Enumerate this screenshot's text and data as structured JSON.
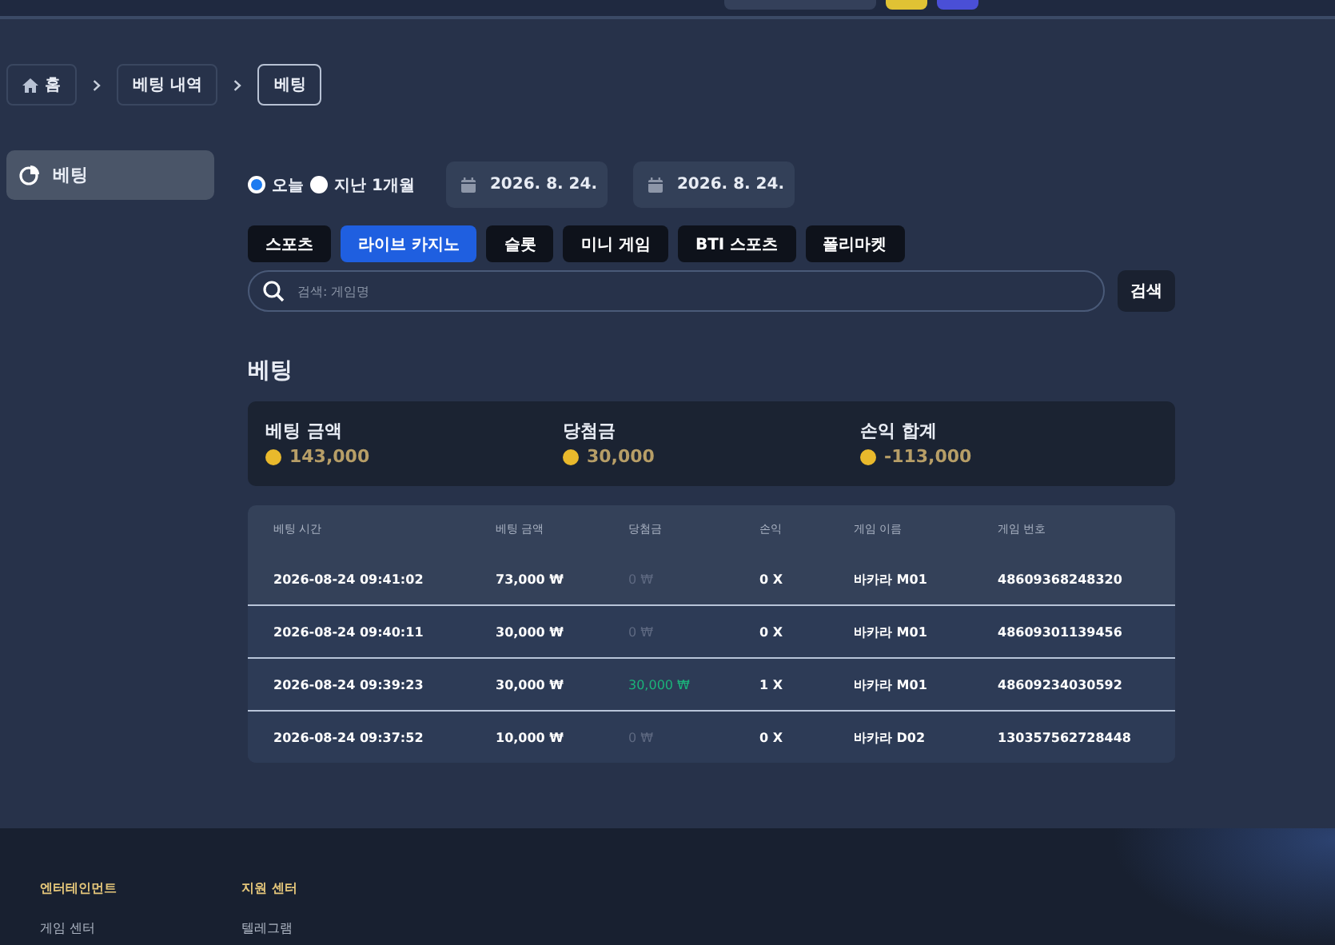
{
  "breadcrumb": [
    {
      "label": "홈",
      "kind": "home",
      "selected": false
    },
    {
      "label": "베팅 내역",
      "kind": "link",
      "selected": false
    },
    {
      "label": "베팅",
      "kind": "link",
      "selected": true
    }
  ],
  "sidebar": {
    "items": [
      {
        "label": "베팅",
        "selected": true
      }
    ]
  },
  "period": [
    {
      "label": "오늘",
      "selected": true
    },
    {
      "label": "지난 1개월",
      "selected": false
    }
  ],
  "dates": [
    "2026. 8. 24.",
    "2026. 8. 24."
  ],
  "categories": [
    {
      "label": "스포츠",
      "selected": false
    },
    {
      "label": "라이브 카지노",
      "selected": true
    },
    {
      "label": "슬롯",
      "selected": false
    },
    {
      "label": "미니 게임",
      "selected": false
    },
    {
      "label": "BTI 스포츠",
      "selected": false
    },
    {
      "label": "폴리마켓",
      "selected": false
    }
  ],
  "search": {
    "placeholder": "검색: 게임명",
    "button": "검색"
  },
  "section_title": "베팅",
  "summary": [
    {
      "label": "베팅 금액",
      "value": "143,000"
    },
    {
      "label": "당첨금",
      "value": "30,000"
    },
    {
      "label": "손익 합계",
      "value": "-113,000"
    }
  ],
  "table": {
    "columns": [
      "베팅 시간",
      "베팅 금액",
      "당첨금",
      "손익",
      "게임 이름",
      "게임 번호"
    ],
    "rows": [
      {
        "time": "2026-08-24 09:41:02",
        "amount": "73,000 ₩",
        "win": "0 ₩",
        "won": false,
        "profit": "0 X",
        "game": "바카라 M01",
        "number": "48609368248320"
      },
      {
        "time": "2026-08-24 09:40:11",
        "amount": "30,000 ₩",
        "win": "0 ₩",
        "won": false,
        "profit": "0 X",
        "game": "바카라 M01",
        "number": "48609301139456"
      },
      {
        "time": "2026-08-24 09:39:23",
        "amount": "30,000 ₩",
        "win": "30,000 ₩",
        "won": true,
        "profit": "1 X",
        "game": "바카라 M01",
        "number": "48609234030592"
      },
      {
        "time": "2026-08-24 09:37:52",
        "amount": "10,000 ₩",
        "win": "0 ₩",
        "won": false,
        "profit": "0 X",
        "game": "바카라 D02",
        "number": "130357562728448"
      }
    ]
  },
  "footer": {
    "columns": [
      {
        "title": "엔터테인먼트",
        "links": [
          "게임 센터"
        ]
      },
      {
        "title": "지원 센터",
        "links": [
          "텔레그램"
        ]
      }
    ]
  }
}
